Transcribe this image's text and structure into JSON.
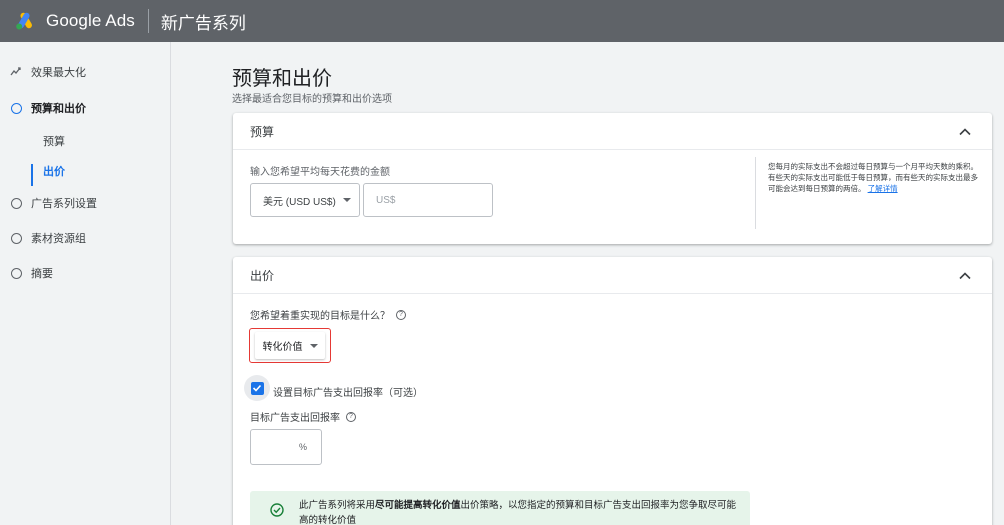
{
  "header": {
    "brand": "Google Ads",
    "campaign_title": "新广告系列"
  },
  "sidebar": {
    "items": [
      {
        "label": "效果最大化",
        "icon": "sparkle-icon"
      },
      {
        "label": "预算和出价",
        "icon": "circle-icon",
        "active": true
      },
      {
        "label": "广告系列设置",
        "icon": "circle-icon"
      },
      {
        "label": "素材资源组",
        "icon": "circle-icon"
      },
      {
        "label": "摘要",
        "icon": "circle-icon"
      }
    ],
    "subitems": [
      {
        "label": "预算"
      },
      {
        "label": "出价",
        "active": true
      }
    ]
  },
  "main": {
    "title": "预算和出价",
    "subtitle": "选择最适合您目标的预算和出价选项",
    "budget": {
      "header": "预算",
      "label": "输入您希望平均每天花费的金额",
      "currency": "美元 (USD US$)",
      "amount_placeholder": "US$",
      "help_text": "您每月的实际支出不会超过每日预算与一个月平均天数的乘积。有些天的实际支出可能低于每日预算，而有些天的实际支出最多可能会达到每日预算的两倍。",
      "help_link": "了解详情"
    },
    "bidding": {
      "header": "出价",
      "goal_question": "您希望着重实现的目标是什么？",
      "goal_value": "转化价值",
      "checkbox_label": "设置目标广告支出回报率（可选）",
      "roas_label": "目标广告支出回报率",
      "roas_unit": "%",
      "info_prefix": "此广告系列将采用",
      "info_bold": "尽可能提高转化价值",
      "info_suffix": "出价策略，以您指定的预算和目标广告支出回报率为您争取尽可能高的转化价值"
    }
  },
  "colors": {
    "topbar": "#5f6368",
    "accent": "#1a73e8",
    "highlight_border": "#e53935",
    "info_bg": "#e6f4ea"
  }
}
